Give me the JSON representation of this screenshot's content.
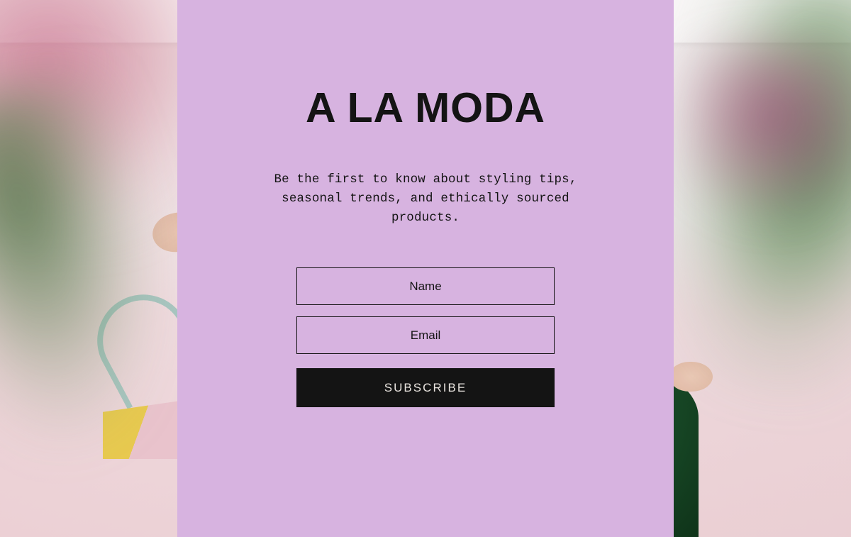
{
  "card": {
    "title": "A LA MODA",
    "subtitle": "Be the first to know about styling tips, seasonal trends, and ethically sourced products."
  },
  "form": {
    "name_placeholder": "Name",
    "email_placeholder": "Email",
    "subscribe_label": "SUBSCRIBE"
  },
  "colors": {
    "card_bg": "#d7b3e0",
    "text": "#141414",
    "button_bg": "#141414",
    "button_text": "#e9e4df"
  }
}
